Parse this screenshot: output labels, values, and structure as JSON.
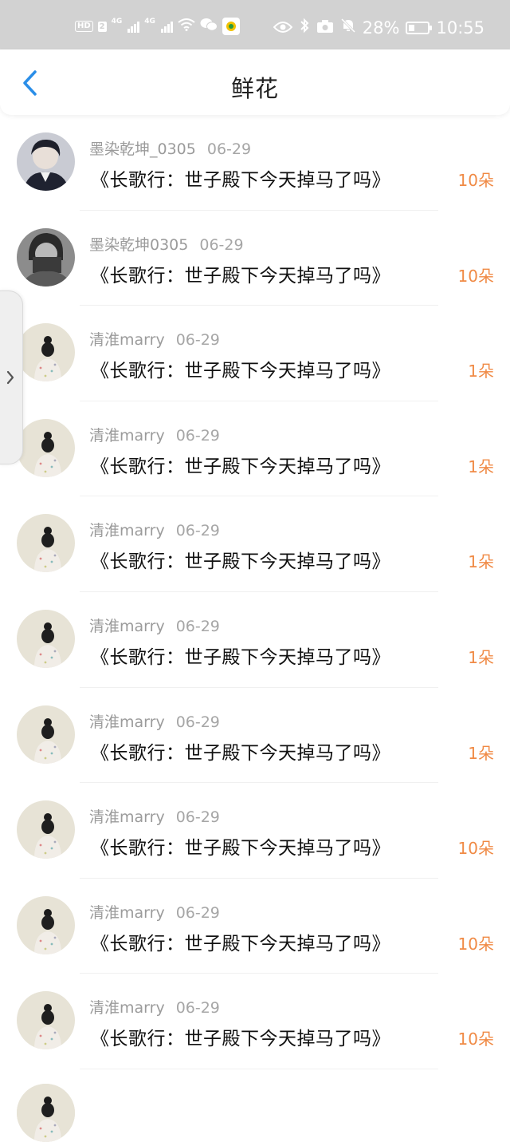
{
  "status_bar": {
    "hd": "HD",
    "sim": "2",
    "net1": "4G",
    "net2": "4G",
    "battery_percent": "28%",
    "battery_level": 0.28,
    "time": "10:55",
    "icons": [
      "hd-icon",
      "signal-icon",
      "wifi-icon",
      "wechat-icon",
      "app-icon",
      "eye-icon",
      "bluetooth-icon",
      "camera-icon",
      "mute-bell-icon",
      "battery-icon"
    ]
  },
  "header": {
    "title": "鲜花",
    "back_icon": "chevron-left-icon",
    "accent": "#2a8ee8"
  },
  "colors": {
    "amount": "#f08a45",
    "username": "#9b9b9b",
    "title": "#111111"
  },
  "items": [
    {
      "user": "墨染乾坤_0305",
      "date": "06-29",
      "title": "《长歌行：世子殿下今天掉马了吗》",
      "amount": "10朵",
      "avatar": "avatar-dark-portrait"
    },
    {
      "user": "墨染乾坤0305",
      "date": "06-29",
      "title": "《长歌行：世子殿下今天掉马了吗》",
      "amount": "10朵",
      "avatar": "avatar-gray-portrait"
    },
    {
      "user": "清淮marry",
      "date": "06-29",
      "title": "《长歌行：世子殿下今天掉马了吗》",
      "amount": "1朵",
      "avatar": "avatar-girl-back"
    },
    {
      "user": "清淮marry",
      "date": "06-29",
      "title": "《长歌行：世子殿下今天掉马了吗》",
      "amount": "1朵",
      "avatar": "avatar-girl-back"
    },
    {
      "user": "清淮marry",
      "date": "06-29",
      "title": "《长歌行：世子殿下今天掉马了吗》",
      "amount": "1朵",
      "avatar": "avatar-girl-back"
    },
    {
      "user": "清淮marry",
      "date": "06-29",
      "title": "《长歌行：世子殿下今天掉马了吗》",
      "amount": "1朵",
      "avatar": "avatar-girl-back"
    },
    {
      "user": "清淮marry",
      "date": "06-29",
      "title": "《长歌行：世子殿下今天掉马了吗》",
      "amount": "1朵",
      "avatar": "avatar-girl-back"
    },
    {
      "user": "清淮marry",
      "date": "06-29",
      "title": "《长歌行：世子殿下今天掉马了吗》",
      "amount": "10朵",
      "avatar": "avatar-girl-back"
    },
    {
      "user": "清淮marry",
      "date": "06-29",
      "title": "《长歌行：世子殿下今天掉马了吗》",
      "amount": "10朵",
      "avatar": "avatar-girl-back"
    },
    {
      "user": "清淮marry",
      "date": "06-29",
      "title": "《长歌行：世子殿下今天掉马了吗》",
      "amount": "10朵",
      "avatar": "avatar-girl-back"
    }
  ]
}
